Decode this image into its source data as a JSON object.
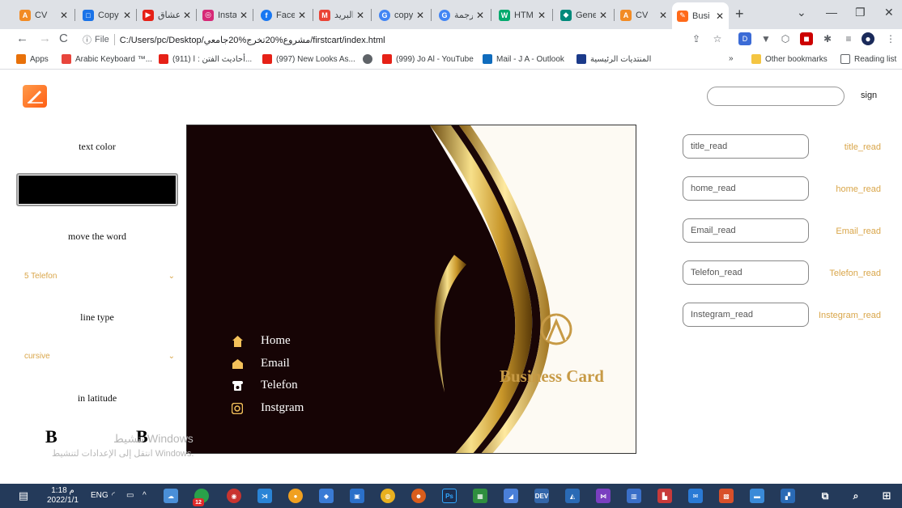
{
  "tabs": [
    {
      "label": "CV",
      "color": "#f28b24",
      "glyph": "A"
    },
    {
      "label": "Copy",
      "color": "#1a73e8",
      "glyph": "□"
    },
    {
      "label": "عشاق",
      "color": "#e62117",
      "glyph": "▶"
    },
    {
      "label": "Insta",
      "color": "#d62976",
      "glyph": "◎"
    },
    {
      "label": "Facel",
      "color": "#1877f2",
      "glyph": "f"
    },
    {
      "label": "البريد",
      "color": "#ea4335",
      "glyph": "M"
    },
    {
      "label": "copy",
      "color": "#4285f4",
      "glyph": "G"
    },
    {
      "label": "ترجمة",
      "color": "#4285f4",
      "glyph": "G"
    },
    {
      "label": "HTM",
      "color": "#04aa6d",
      "glyph": "W"
    },
    {
      "label": "Gene",
      "color": "#00897b",
      "glyph": "◆"
    },
    {
      "label": "CV",
      "color": "#f28b24",
      "glyph": "A"
    },
    {
      "label": "Busi",
      "color": "#ff6a1a",
      "glyph": "✎"
    }
  ],
  "address": {
    "file_label": "File",
    "url": "C:/Users/pc/Desktop/مشروع%20تخرج%20جامعي/firstcart/index.html"
  },
  "bookmarks": [
    {
      "label": "Apps",
      "color": "#e8710a"
    },
    {
      "label": "Arabic Keyboard ™...",
      "color": "#e8453c"
    },
    {
      "label": "(911) أحاديث الفتن : ا...",
      "color": "#e62117"
    },
    {
      "label": "(997) New Looks As...",
      "color": "#e62117"
    },
    {
      "label": "",
      "color": "#5f6368"
    },
    {
      "label": "(999) Jo Al - YouTube",
      "color": "#e62117"
    },
    {
      "label": "Mail - J A - Outlook",
      "color": "#0f6cbd"
    },
    {
      "label": "المنتديات الرئيسية",
      "color": "#1b3a8a"
    },
    {
      "label": "»",
      "color": ""
    },
    {
      "label": "Other bookmarks",
      "color": "#f4c542"
    },
    {
      "label": "Reading list",
      "color": "#5f6368"
    }
  ],
  "page": {
    "sign": "sign",
    "text_color_label": "text color",
    "move_word_label": "move the word",
    "move_word_value": "5 Telefon",
    "line_type_label": "line type",
    "line_type_value": "cursive",
    "latitude_label": "in latitude",
    "bold_left": "B",
    "bold_right": "B"
  },
  "card": {
    "menu": [
      {
        "label": "Home",
        "icon": "home-icon"
      },
      {
        "label": "Email",
        "icon": "email-icon"
      },
      {
        "label": "Telefon",
        "icon": "phone-icon"
      },
      {
        "label": "Instgram",
        "icon": "instagram-icon"
      }
    ],
    "brand": "Business Card",
    "accent": "#c79a45",
    "background": "#160405"
  },
  "fields": [
    {
      "placeholder": "title_read",
      "label": "title_read"
    },
    {
      "placeholder": "home_read",
      "label": "home_read"
    },
    {
      "placeholder": "Email_read",
      "label": "Email_read"
    },
    {
      "placeholder": "Telefon_read",
      "label": "Telefon_read"
    },
    {
      "placeholder": "Instegram_read",
      "label": "Instegram_read"
    }
  ],
  "watermark": {
    "line1": "تنشيط Windows",
    "line2": "انتقل إلى الإعدادات لتنشيط Windows."
  },
  "taskbar": {
    "time": "1:18 م",
    "date": "2022/1/1",
    "lang": "ENG",
    "badge": "12"
  }
}
